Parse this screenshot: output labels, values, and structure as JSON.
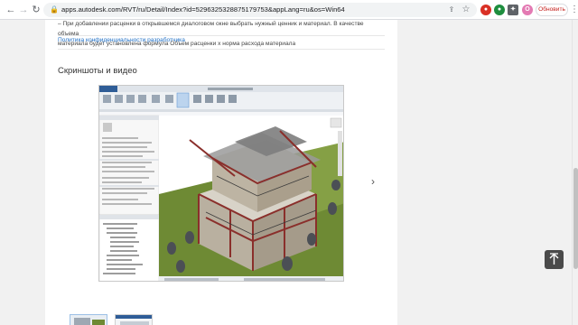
{
  "browser": {
    "url": "apps.autodesk.com/RVT/ru/Detail/Index?id=5296325328875179753&appLang=ru&os=Win64",
    "update_label": "Обновить",
    "profile_initial": "О",
    "icons": [
      "back-arrow-icon",
      "forward-arrow-icon",
      "reload-icon",
      "lock-icon",
      "share-icon",
      "star-icon",
      "extension-icon",
      "puzzle-icon",
      "menu-icon"
    ]
  },
  "page": {
    "description_lines": [
      "– При добавлении расценки в открывшемся диалоговом окне выбрать нужный ценник и материал. В качестве объема",
      "материала будет установлена формула Объем расценки x норма расхода материала"
    ],
    "privacy_link": "Политика конфиденциальности разработчика",
    "section_title": "Скриншоты и видео",
    "next_arrow": "›",
    "back_to_top": "↑"
  },
  "colors": {
    "link": "#1f6fc5",
    "revit_green": "#6e8a34",
    "house_wall": "#b9b0a0",
    "house_frame": "#8a2f2b",
    "update_text": "#c5221f"
  }
}
